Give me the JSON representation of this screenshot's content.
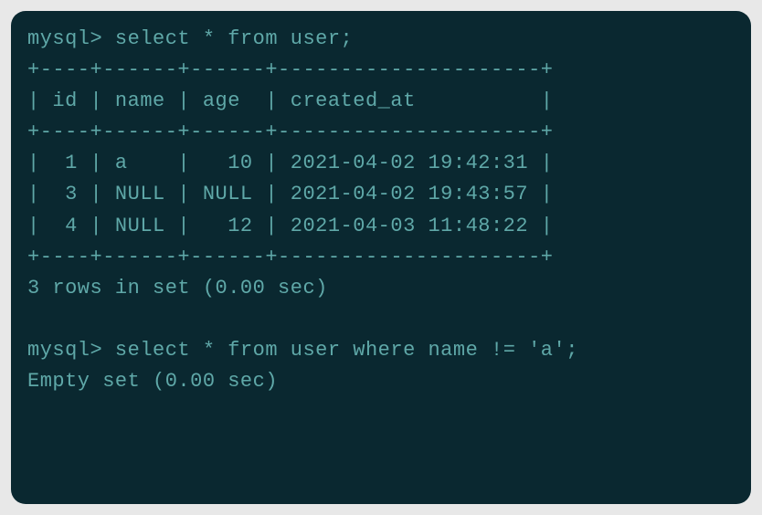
{
  "session": {
    "prompt": "mysql>",
    "query1": "select * from user;",
    "table": {
      "separator_top": "+----+------+------+---------------------+",
      "header_row": "| id | name | age  | created_at          |",
      "separator_mid": "+----+------+------+---------------------+",
      "rows": [
        "|  1 | a    |   10 | 2021-04-02 19:42:31 |",
        "|  3 | NULL | NULL | 2021-04-02 19:43:57 |",
        "|  4 | NULL |   12 | 2021-04-03 11:48:22 |"
      ],
      "separator_bot": "+----+------+------+---------------------+"
    },
    "result1": "3 rows in set (0.00 sec)",
    "blank": "",
    "query2": "select * from user where name != 'a';",
    "result2": "Empty set (0.00 sec)"
  }
}
